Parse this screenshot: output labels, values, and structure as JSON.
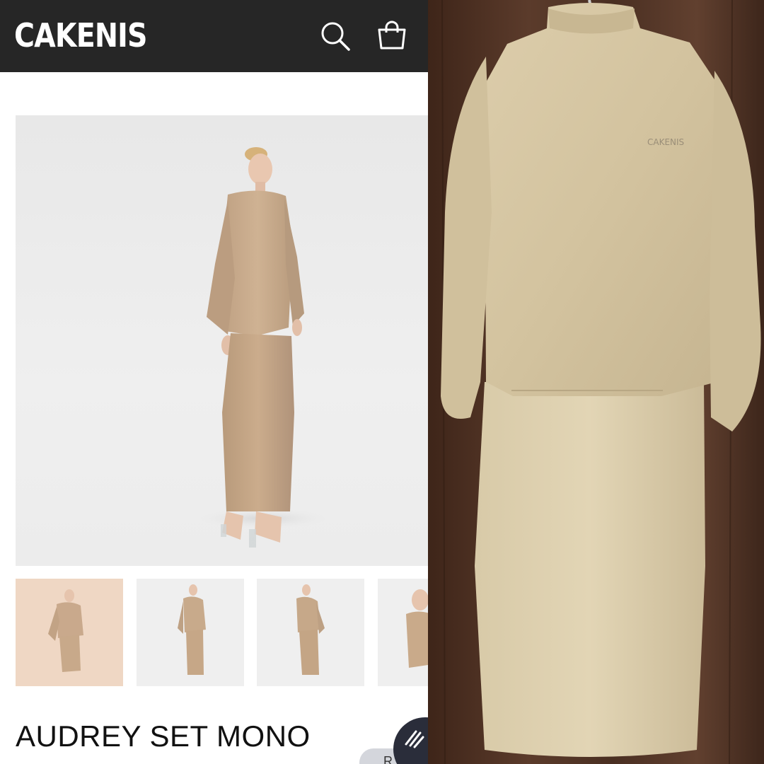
{
  "header": {
    "brand": "CAKENIS",
    "search_icon": "search-icon",
    "bag_icon": "shopping-bag-icon"
  },
  "product": {
    "title": "AUDREY SET MONO"
  },
  "gallery": {
    "thumbnails": [
      {
        "style": "beige-background"
      },
      {
        "style": "white-background"
      },
      {
        "style": "white-background"
      },
      {
        "style": "white-background"
      }
    ]
  },
  "chat": {
    "icon": "chat-icon",
    "pill_label": "R"
  },
  "photo": {
    "garment_label": "CAKENIS"
  },
  "colors": {
    "header_bg": "#262626",
    "garment": "#c9ab8a",
    "garment_real": "#d6c7a4",
    "wood": "#5b3b2b"
  }
}
